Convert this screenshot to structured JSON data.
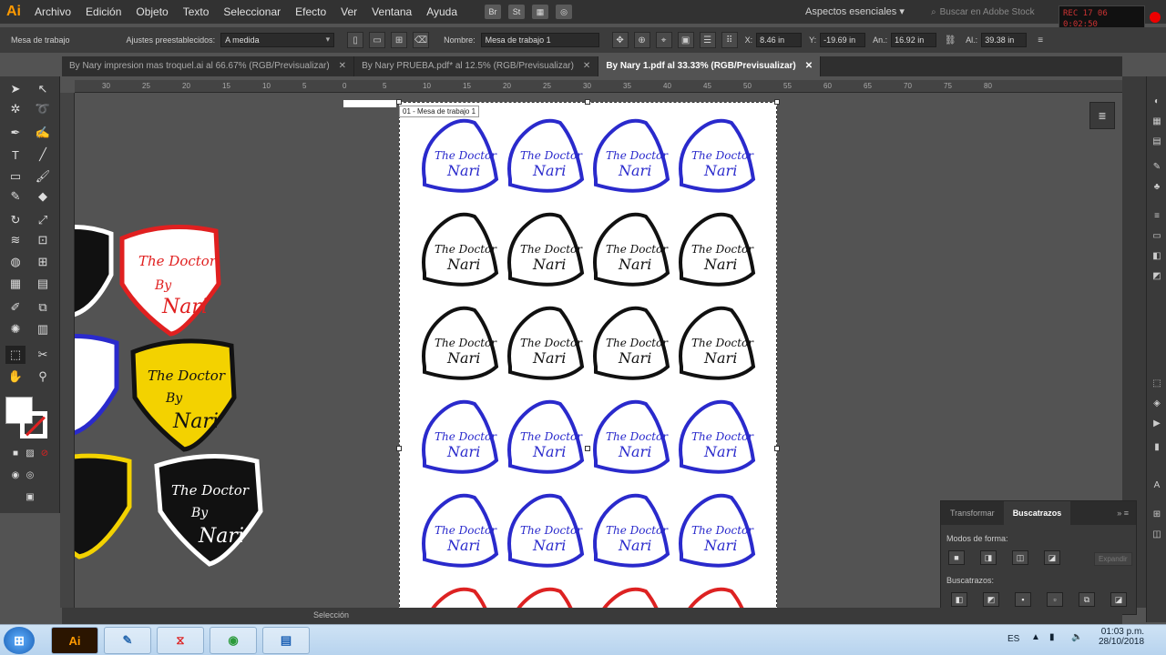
{
  "menubar": {
    "app_logo": "Ai",
    "items": [
      "Archivo",
      "Edición",
      "Objeto",
      "Texto",
      "Seleccionar",
      "Efecto",
      "Ver",
      "Ventana",
      "Ayuda"
    ],
    "bridge_label": "Br",
    "stock_label": "St",
    "workspace": "Aspectos esenciales",
    "stock_search_placeholder": "Buscar en Adobe Stock",
    "timer_line1": "REC 17  06",
    "timer_line2": "0:02:50"
  },
  "control_bar": {
    "artboard_label": "Mesa de trabajo",
    "presets_label": "Ajustes preestablecidos:",
    "presets_value": "A medida",
    "name_label": "Nombre:",
    "name_value": "Mesa de trabajo 1",
    "x_label": "X:",
    "x_value": "8.46 in",
    "y_label": "Y:",
    "y_value": "-19.69 in",
    "w_label": "An.:",
    "w_value": "16.92 in",
    "h_label": "Al.:",
    "h_value": "39.38 in"
  },
  "tabs": [
    {
      "label": "By Nary impresion mas troquel.ai al 66.67% (RGB/Previsualizar)",
      "active": false
    },
    {
      "label": "By Nary PRUEBA.pdf* al 12.5% (RGB/Previsualizar)",
      "active": false
    },
    {
      "label": "By Nary 1.pdf al 33.33% (RGB/Previsualizar)",
      "active": true
    }
  ],
  "ruler_marks": [
    "30",
    "25",
    "20",
    "15",
    "10",
    "5",
    "0",
    "5",
    "10",
    "15",
    "20",
    "25",
    "30",
    "35",
    "40",
    "45",
    "50",
    "55",
    "60",
    "65",
    "70",
    "75",
    "80"
  ],
  "artboard": {
    "label": "01 - Mesa de trabajo 1"
  },
  "sticker_text": {
    "line1": "The Doctor",
    "line2": "By",
    "line3": "Nari"
  },
  "sticker_rows": [
    {
      "color": "#2a2acc"
    },
    {
      "color": "#111111"
    },
    {
      "color": "#111111"
    },
    {
      "color": "#2a2acc"
    },
    {
      "color": "#2a2acc"
    },
    {
      "color": "#dd2222"
    }
  ],
  "status_bar": {
    "tool": "Selección"
  },
  "pathfinder": {
    "tab_transform": "Transformar",
    "tab_pathfinder": "Buscatrazos",
    "shape_modes_label": "Modos de forma:",
    "expand_label": "Expandir",
    "pathfinders_label": "Buscatrazos:"
  },
  "taskbar": {
    "language": "ES",
    "time": "01:03 p.m.",
    "date": "28/10/2018",
    "apps": [
      "Ai",
      "",
      "",
      "",
      ""
    ]
  },
  "colors": {
    "accent_ai": "#ff9a00",
    "sticker_red": "#dd2222",
    "sticker_yellow": "#f3d200",
    "sticker_blue": "#2a2acc"
  }
}
